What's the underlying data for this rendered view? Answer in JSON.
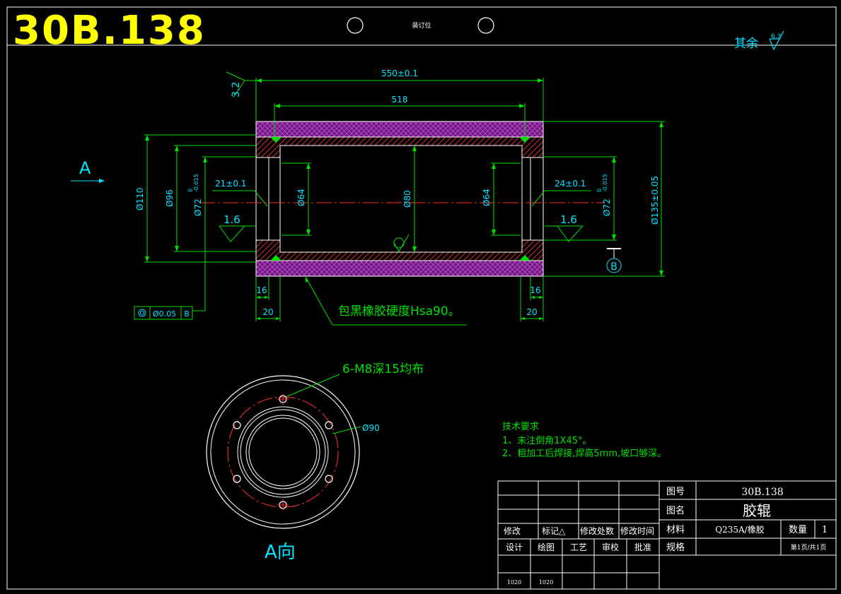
{
  "sheet": {
    "drawing_code": "30B.138",
    "binding_label": "装订位",
    "other_roughness_label": "其余",
    "other_roughness_value": "6.3"
  },
  "dims": {
    "overall_length": "550±0.1",
    "inner_length": "518",
    "roughness_end": "3.2",
    "dia_110": "Ø110",
    "dia_96": "Ø96",
    "dia_72_left": "Ø72",
    "tol_upper": "0",
    "tol_lower": "-0.015",
    "depth_left": "21±0.1",
    "depth_right": "24±0.1",
    "roughness_left": "1.6",
    "roughness_right": "1.6",
    "dia_64_left": "Ø64",
    "dia_80": "Ø80",
    "dia_64_right": "Ø64",
    "dia_72_right": "Ø72",
    "dia_135": "Ø135±0.05",
    "datum_b": "B",
    "len_16_left": "16",
    "len_20_left": "20",
    "len_16_right": "16",
    "len_20_right": "20",
    "rubber_note": "包黑橡胶硬度Hsa90。",
    "concentricity_tol": "Ø0.05",
    "concentricity_datum": "B",
    "view_marker": "A"
  },
  "end_view": {
    "holes_note": "6-M8深15均布",
    "pcd": "Ø90",
    "title": "A向"
  },
  "tech_req": {
    "heading": "技术要求",
    "item1": "1、未注倒角1X45°。",
    "item2": "2、粗加工后焊接,焊高5mm,坡口够深。"
  },
  "title_block": {
    "label_drawing_no": "图号",
    "drawing_no": "30B.138",
    "label_name": "图名",
    "name": "胶辊",
    "label_material": "材料",
    "material": "Q235A/橡胶",
    "label_qty": "数量",
    "qty": "1",
    "label_spec": "规格",
    "page": "第1页/共1页",
    "rev_headers": [
      "修改",
      "标记△",
      "修改处数",
      "修改时间"
    ],
    "sign_headers": [
      "设计",
      "绘图",
      "工艺",
      "审校",
      "批准"
    ],
    "date_design": "1020",
    "date_drawing": "1020"
  }
}
